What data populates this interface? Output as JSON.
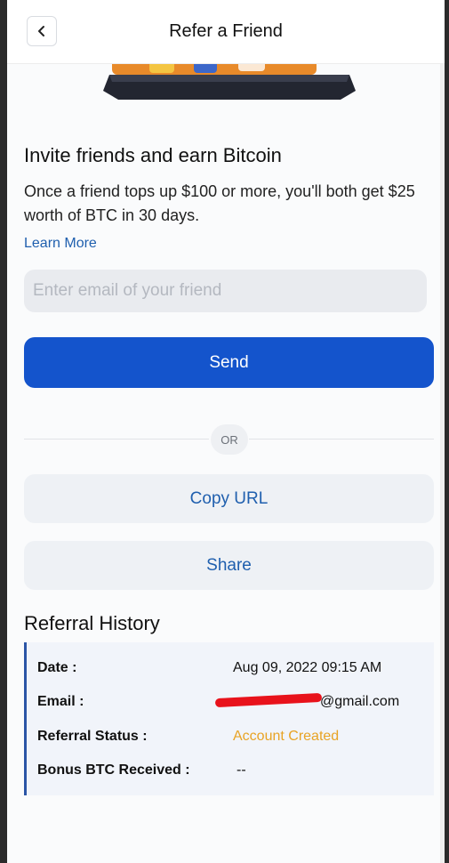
{
  "header": {
    "title": "Refer a Friend",
    "back_icon": "chevron-left-icon"
  },
  "invite": {
    "heading": "Invite friends and earn Bitcoin",
    "description": "Once a friend tops up $100 or more, you'll both get $25 worth of BTC in 30 days.",
    "learn_more": "Learn More",
    "email_placeholder": "Enter email of your friend",
    "send_label": "Send",
    "or_label": "OR",
    "copy_url_label": "Copy URL",
    "share_label": "Share"
  },
  "history": {
    "heading": "Referral History",
    "rows": [
      {
        "key": "Date :",
        "value": "Aug 09, 2022 09:15 AM"
      },
      {
        "key": "Email :",
        "value": "@gmail.com"
      },
      {
        "key": "Referral Status :",
        "value": "Account Created"
      },
      {
        "key": "Bonus BTC Received :",
        "value": "--"
      }
    ]
  },
  "colors": {
    "primary": "#1454cc",
    "link": "#1f5fae",
    "status": "#e8a325",
    "redaction": "#e8121b"
  }
}
